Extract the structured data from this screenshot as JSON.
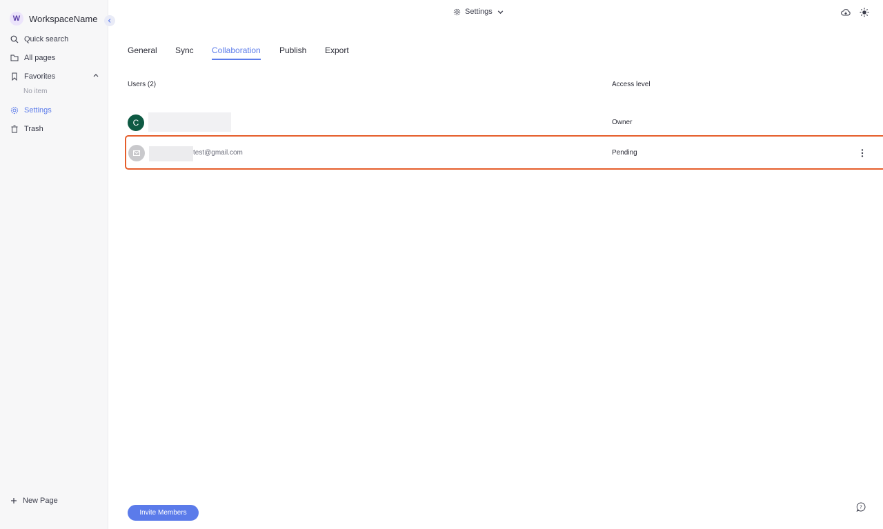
{
  "workspace": {
    "initial": "W",
    "name": "WorkspaceName"
  },
  "sidebar": {
    "items": [
      {
        "label": "Quick search",
        "icon": "search-icon"
      },
      {
        "label": "All pages",
        "icon": "folder-icon"
      },
      {
        "label": "Favorites",
        "icon": "bookmark-icon"
      },
      {
        "label": "Settings",
        "icon": "gear-icon"
      },
      {
        "label": "Trash",
        "icon": "trash-icon"
      }
    ],
    "favorites_empty": "No item",
    "new_page": "New Page"
  },
  "header": {
    "title": "Settings"
  },
  "tabs": [
    {
      "label": "General"
    },
    {
      "label": "Sync"
    },
    {
      "label": "Collaboration",
      "active": true
    },
    {
      "label": "Publish"
    },
    {
      "label": "Export"
    }
  ],
  "table": {
    "users_header": "Users (2)",
    "access_header": "Access level",
    "rows": [
      {
        "avatar": "C",
        "avatar_color": "#0e5a43",
        "access": "Owner"
      },
      {
        "email": "test@gmail.com",
        "access": "Pending"
      }
    ]
  },
  "invite_button": "Invite Members",
  "colors": {
    "accent": "#5b7bea",
    "highlight": "#e55d2a"
  }
}
